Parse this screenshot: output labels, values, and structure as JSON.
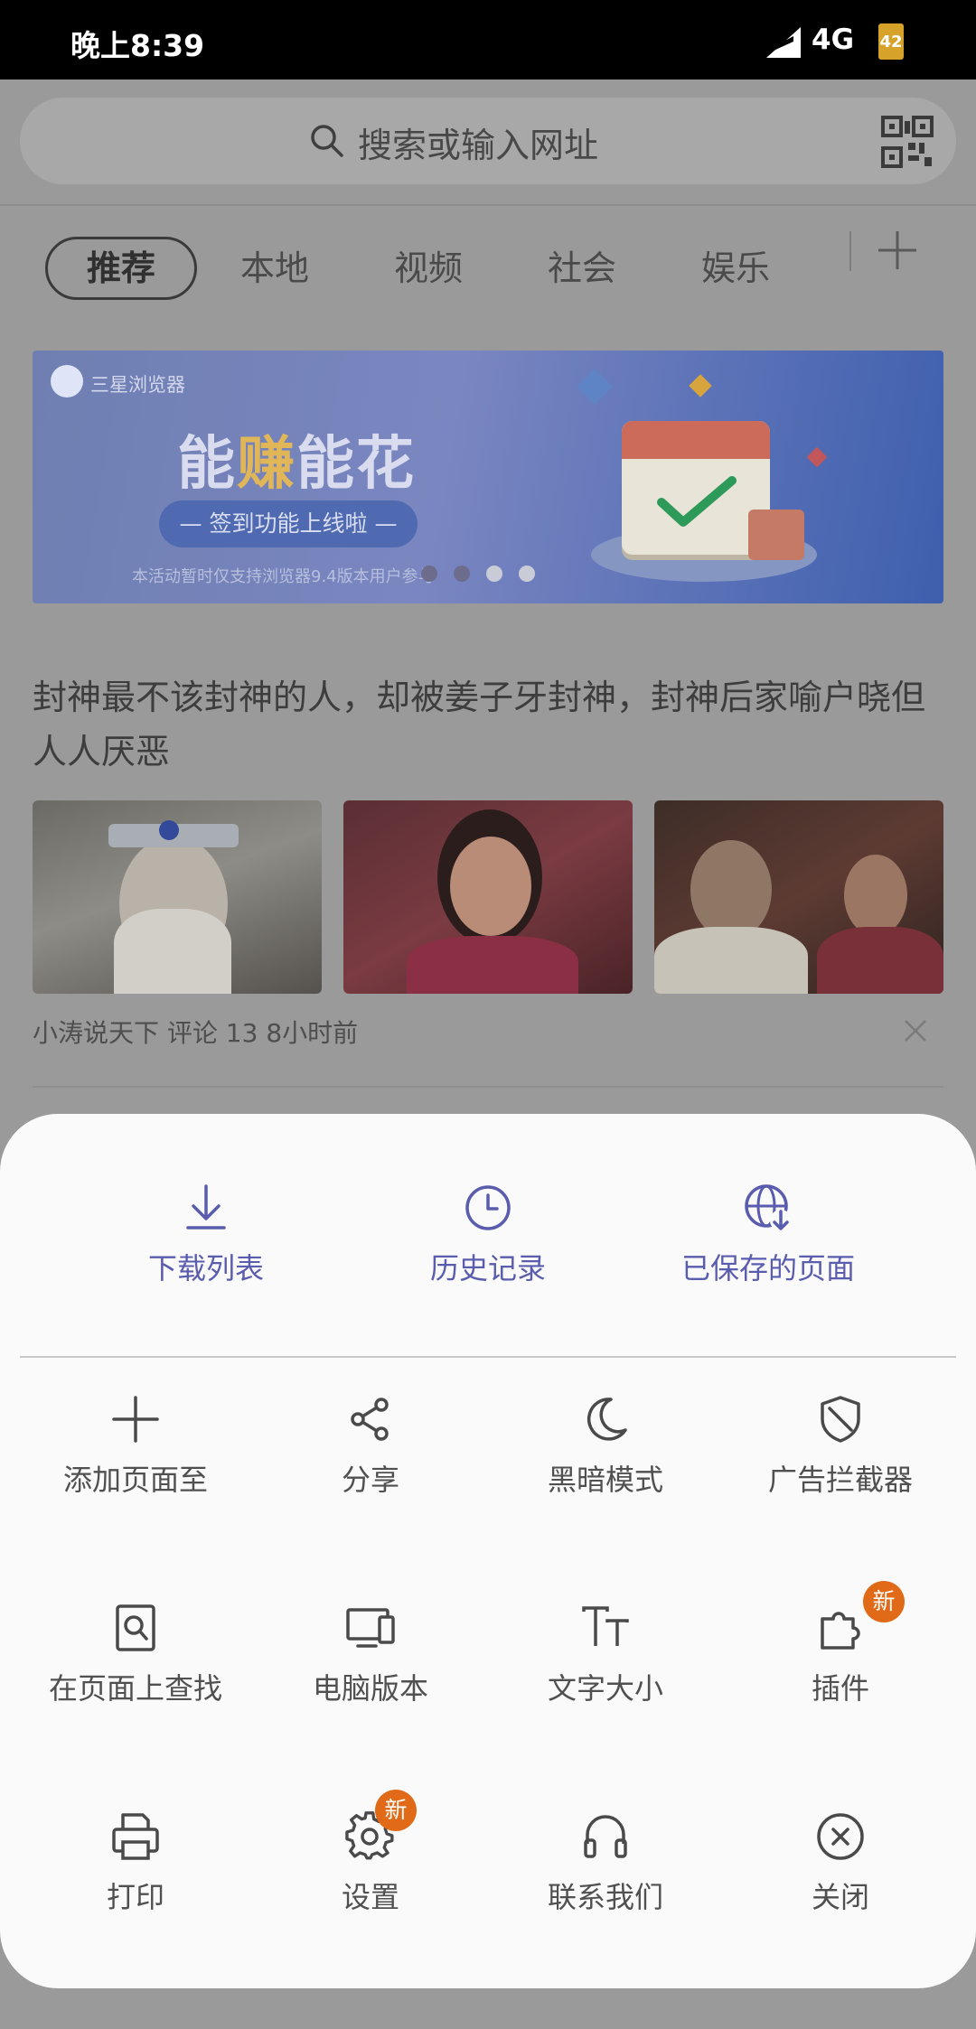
{
  "status_bar": {
    "time": "晚上8:39",
    "network": "4G",
    "battery": "42"
  },
  "search": {
    "placeholder": "搜索或输入网址"
  },
  "tabs": [
    {
      "label": "推荐",
      "active": true
    },
    {
      "label": "本地"
    },
    {
      "label": "视频"
    },
    {
      "label": "社会"
    },
    {
      "label": "娱乐"
    }
  ],
  "banner": {
    "brand": "三星浏览器",
    "headline_1": "能",
    "headline_2": "赚",
    "headline_3": "能花",
    "pill": "— 签到功能上线啦 —",
    "note": "本活动暂时仅支持浏览器9.4版本用户参与"
  },
  "article": {
    "title": "封神最不该封神的人，却被姜子牙封神，封神后家喻户晓但人人厌恶",
    "meta": "小涛说天下 评论 13 8小时前"
  },
  "menu": {
    "top": [
      {
        "label": "下载列表",
        "icon": "download-icon"
      },
      {
        "label": "历史记录",
        "icon": "history-icon"
      },
      {
        "label": "已保存的页面",
        "icon": "saved-pages-icon"
      }
    ],
    "grid": [
      {
        "label": "添加页面至",
        "icon": "plus-icon"
      },
      {
        "label": "分享",
        "icon": "share-icon"
      },
      {
        "label": "黑暗模式",
        "icon": "moon-icon"
      },
      {
        "label": "广告拦截器",
        "icon": "shield-icon"
      },
      {
        "label": "在页面上查找",
        "icon": "find-in-page-icon"
      },
      {
        "label": "电脑版本",
        "icon": "desktop-icon"
      },
      {
        "label": "文字大小",
        "icon": "text-size-icon"
      },
      {
        "label": "插件",
        "icon": "puzzle-icon",
        "badge": "新"
      },
      {
        "label": "打印",
        "icon": "print-icon"
      },
      {
        "label": "设置",
        "icon": "gear-icon",
        "badge": "新"
      },
      {
        "label": "联系我们",
        "icon": "headset-icon"
      },
      {
        "label": "关闭",
        "icon": "close-circle-icon"
      }
    ]
  },
  "colors": {
    "accent": "#5a5cad",
    "badge": "#e06a17",
    "sheet": "#fafafa",
    "dim_overlay": "#9a9a9a"
  }
}
